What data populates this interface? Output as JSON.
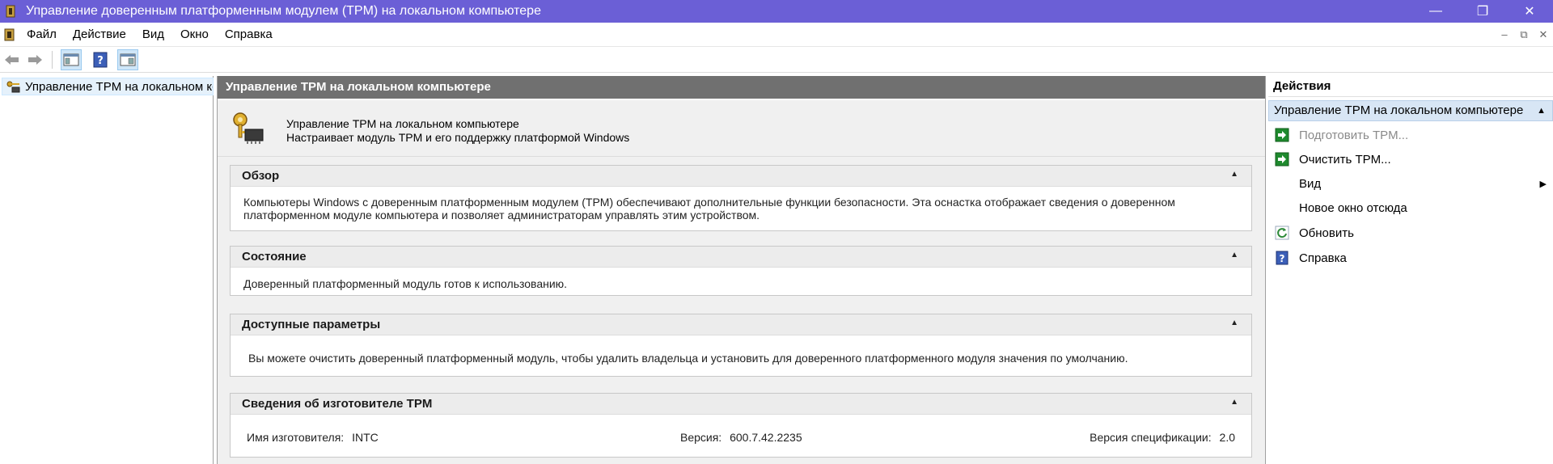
{
  "window": {
    "title": "Управление доверенным платформенным модулем (TPM) на локальном компьютере",
    "minimize": "—",
    "maximize": "❐",
    "close": "✕"
  },
  "menu": {
    "items": [
      "Файл",
      "Действие",
      "Вид",
      "Окно",
      "Справка"
    ],
    "mdi_minimize": "–",
    "mdi_restore": "⧉",
    "mdi_close": "✕"
  },
  "toolbar": {
    "icons": [
      "back-arrow-icon",
      "forward-arrow-icon",
      "show-hide-tree-icon",
      "help-icon",
      "show-hide-action-pane-icon"
    ]
  },
  "tree": {
    "root_label": "Управление TPM на локальном кс"
  },
  "center": {
    "header": "Управление TPM на локальном компьютере",
    "intro_line1": "Управление TPM на локальном компьютере",
    "intro_line2": "Настраивает модуль TPM и его поддержку платформой Windows",
    "overview": {
      "title": "Обзор",
      "text1": "Компьютеры Windows с доверенным платформенным модулем (TPM) обеспечивают дополнительные функции безопасности. Эта оснастка отображает сведения о доверенном",
      "text2": "платформенном модуле компьютера и позволяет администраторам управлять этим устройством."
    },
    "status": {
      "title": "Состояние",
      "text": "Доверенный платформенный модуль готов к использованию."
    },
    "options": {
      "title": "Доступные параметры",
      "text": "Вы можете очистить доверенный платформенный модуль, чтобы удалить владельца и установить для доверенного платформенного модуля значения по умолчанию."
    },
    "manufacturer": {
      "title": "Сведения об изготовителе TPM",
      "name_label": "Имя изготовителя:",
      "name_value": "INTC",
      "version_label": "Версия:",
      "version_value": "600.7.42.2235",
      "spec_label": "Версия спецификации:",
      "spec_value": "2.0"
    },
    "collapse_glyph": "▲"
  },
  "actions": {
    "header": "Действия",
    "group": "Управление TPM на локальном компьютере",
    "items": [
      {
        "label": "Подготовить TPM...",
        "icon": "green-arrow-icon",
        "disabled": true
      },
      {
        "label": "Очистить TPM...",
        "icon": "green-arrow-icon",
        "disabled": false
      },
      {
        "label": "Вид",
        "icon": "",
        "disabled": false,
        "submenu": true
      },
      {
        "label": "Новое окно отсюда",
        "icon": "",
        "disabled": false
      },
      {
        "label": "Обновить",
        "icon": "refresh-icon",
        "disabled": false
      },
      {
        "label": "Справка",
        "icon": "help-icon",
        "disabled": false
      }
    ],
    "group_caret": "▲",
    "submenu_arrow": "▶"
  },
  "colors": {
    "titlebar": "#6b5fd6",
    "center_header": "#707070",
    "selection": "#d8e6f5"
  }
}
